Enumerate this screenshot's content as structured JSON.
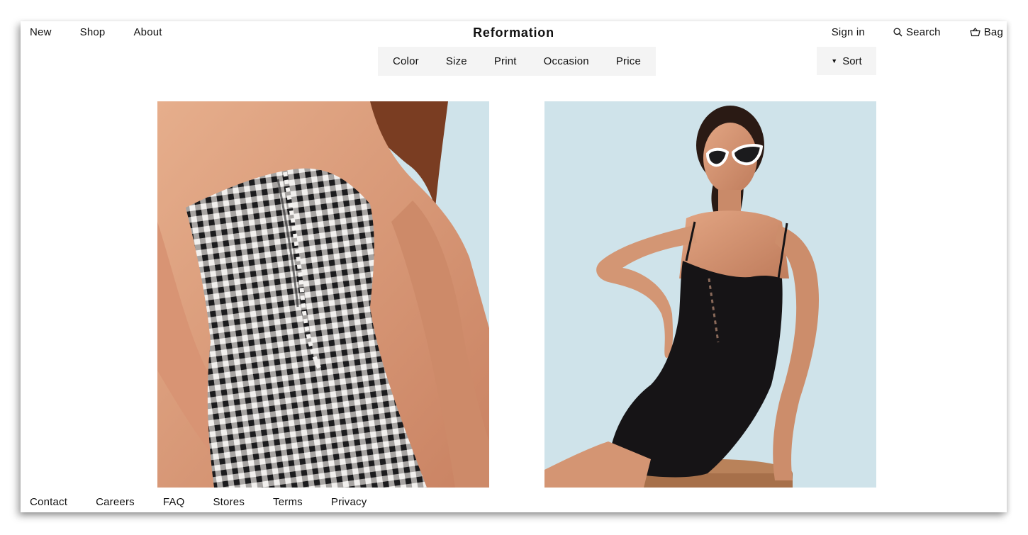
{
  "brand": {
    "name": "Reformation"
  },
  "nav_left": [
    {
      "label": "New"
    },
    {
      "label": "Shop"
    },
    {
      "label": "About"
    }
  ],
  "nav_right": {
    "signin": "Sign in",
    "search": "Search",
    "bag": "Bag"
  },
  "filters": [
    {
      "label": "Color"
    },
    {
      "label": "Size"
    },
    {
      "label": "Print"
    },
    {
      "label": "Occasion"
    },
    {
      "label": "Price"
    }
  ],
  "sort": {
    "label": "Sort",
    "caret": "▼"
  },
  "products": [
    {
      "image": "gingham-strapless-dress-photo"
    },
    {
      "image": "black-lace-up-mini-dress-photo"
    }
  ],
  "footer": [
    {
      "label": "Contact"
    },
    {
      "label": "Careers"
    },
    {
      "label": "FAQ"
    },
    {
      "label": "Stores"
    },
    {
      "label": "Terms"
    },
    {
      "label": "Privacy"
    }
  ],
  "colors": {
    "background": "#ffffff",
    "text": "#111111",
    "filter_bg": "#f4f4f4",
    "photo_backdrop": "#cde1e8"
  }
}
